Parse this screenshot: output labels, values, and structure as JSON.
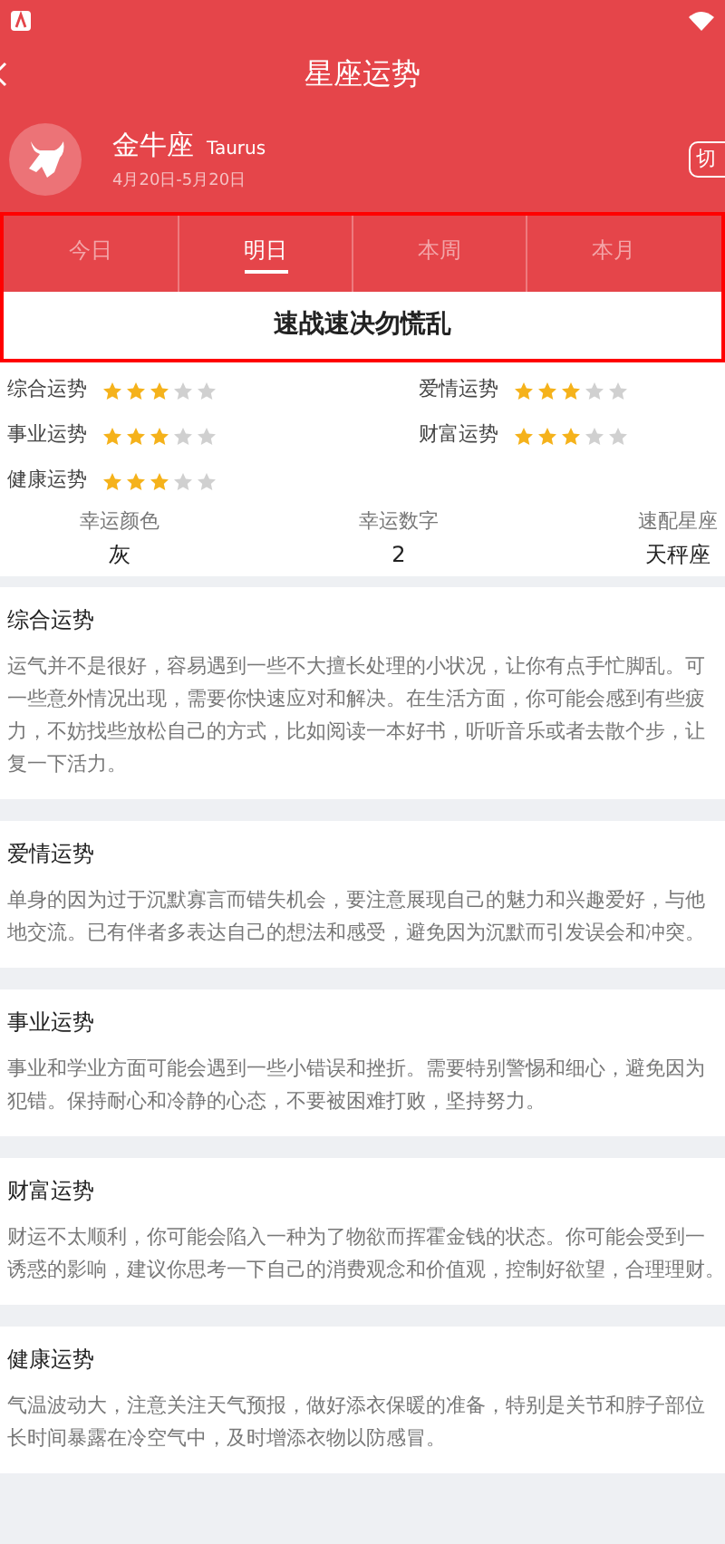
{
  "title": "星座运势",
  "sign": {
    "name": "金牛座",
    "latin": "Taurus",
    "dates": "4月20日-5月20日",
    "switch_label": "切"
  },
  "tabs": [
    {
      "label": "今日",
      "selected": false
    },
    {
      "label": "明日",
      "selected": true
    },
    {
      "label": "本周",
      "selected": false
    },
    {
      "label": "本月",
      "selected": false
    }
  ],
  "keyword": "速战速决勿慌乱",
  "ratings": [
    {
      "label": "综合运势",
      "stars": 3
    },
    {
      "label": "爱情运势",
      "stars": 3
    },
    {
      "label": "事业运势",
      "stars": 3
    },
    {
      "label": "财富运势",
      "stars": 3
    },
    {
      "label": "健康运势",
      "stars": 3
    }
  ],
  "lucky": [
    {
      "label": "幸运颜色",
      "value": "灰"
    },
    {
      "label": "幸运数字",
      "value": "2"
    },
    {
      "label": "速配星座",
      "value": "天秤座"
    }
  ],
  "sections": [
    {
      "title": "综合运势",
      "lines": [
        "运气并不是很好，容易遇到一些不大擅长处理的小状况，让你有点手忙脚乱。可",
        "一些意外情况出现，需要你快速应对和解决。在生活方面，你可能会感到有些疲",
        "力，不妨找些放松自己的方式，比如阅读一本好书，听听音乐或者去散个步，让",
        "复一下活力。"
      ]
    },
    {
      "title": "爱情运势",
      "lines": [
        "单身的因为过于沉默寡言而错失机会，要注意展现自己的魅力和兴趣爱好，与他",
        "地交流。已有伴者多表达自己的想法和感受，避免因为沉默而引发误会和冲突。"
      ]
    },
    {
      "title": "事业运势",
      "lines": [
        "事业和学业方面可能会遇到一些小错误和挫折。需要特别警惕和细心，避免因为",
        "犯错。保持耐心和冷静的心态，不要被困难打败，坚持努力。"
      ]
    },
    {
      "title": "财富运势",
      "lines": [
        "财运不太顺利，你可能会陷入一种为了物欲而挥霍金钱的状态。你可能会受到一",
        "诱惑的影响，建议你思考一下自己的消费观念和价值观，控制好欲望，合理理财。"
      ]
    },
    {
      "title": "健康运势",
      "lines": [
        "气温波动大，注意关注天气预报，做好添衣保暖的准备，特别是关节和脖子部位",
        "长时间暴露在冷空气中，及时增添衣物以防感冒。"
      ]
    }
  ]
}
